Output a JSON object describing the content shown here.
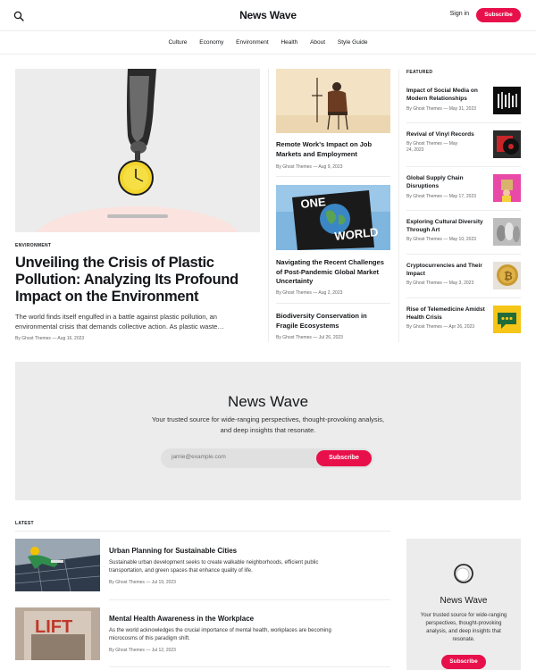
{
  "header": {
    "site_title": "News Wave",
    "signin_label": "Sign in",
    "subscribe_label": "Subscribe",
    "search_icon": "search-icon"
  },
  "nav": {
    "items": [
      {
        "label": "Culture"
      },
      {
        "label": "Economy"
      },
      {
        "label": "Environment"
      },
      {
        "label": "Health"
      },
      {
        "label": "About"
      },
      {
        "label": "Style Guide"
      }
    ]
  },
  "hero": {
    "tag": "ENVIRONMENT",
    "title": "Unveiling the Crisis of Plastic Pollution: Analyzing Its Profound Impact on the Environment",
    "excerpt": "The world finds itself engulfed in a battle against plastic pollution, an environmental crisis that demands collective action. As plastic waste…",
    "meta": "By Ghost Themes — Aug 16, 2023"
  },
  "middle": [
    {
      "title": "Remote Work's Impact on Job Markets and Employment",
      "meta": "By Ghost Themes — Aug 9, 2023"
    },
    {
      "title": "Navigating the Recent Challenges of Post-Pandemic Global Market Uncertainty",
      "meta": "By Ghost Themes — Aug 2, 2023",
      "image_text_1": "ONE",
      "image_text_2": "WORLD"
    },
    {
      "title": "Biodiversity Conservation in Fragile Ecosystems",
      "meta": "By Ghost Themes — Jul 26, 2023"
    }
  ],
  "featured": {
    "label": "FEATURED",
    "items": [
      {
        "title": "Impact of Social Media on Modern Relationships",
        "meta": "By Ghost Themes — May 31, 2023"
      },
      {
        "title": "Revival of Vinyl Records",
        "meta": "By Ghost Themes — May 24, 2023"
      },
      {
        "title": "Global Supply Chain Disruptions",
        "meta": "By Ghost Themes — May 17, 2023"
      },
      {
        "title": "Exploring Cultural Diversity Through Art",
        "meta": "By Ghost Themes — May 10, 2023"
      },
      {
        "title": "Cryptocurrencies and Their Impact",
        "meta": "By Ghost Themes — May 3, 2023"
      },
      {
        "title": "Rise of Telemedicine Amidst Health Crisis",
        "meta": "By Ghost Themes — Apr 26, 2023"
      }
    ]
  },
  "cta": {
    "title": "News Wave",
    "description": "Your trusted source for wide-ranging perspectives, thought-provoking analysis, and deep insights that resonate.",
    "email_placeholder": "jamie@example.com",
    "button_label": "Subscribe"
  },
  "latest": {
    "label": "LATEST",
    "items": [
      {
        "title": "Urban Planning for Sustainable Cities",
        "excerpt": "Sustainable urban development seeks to create walkable neighborhoods, efficient public transportation, and green spaces that enhance quality of life.",
        "meta": "By Ghost Themes — Jul 19, 2023"
      },
      {
        "title": "Mental Health Awareness in the Workplace",
        "excerpt": "As the world acknowledges the crucial importance of mental health, workplaces are becoming microcosms of this paradigm shift.",
        "meta": "By Ghost Themes — Jul 12, 2023",
        "image_text": "LIFT"
      }
    ]
  },
  "side_card": {
    "title": "News Wave",
    "description": "Your trusted source for wide-ranging perspectives, thought-provoking analysis, and deep insights that resonate.",
    "button_label": "Subscribe"
  },
  "colors": {
    "accent": "#e8104b",
    "panel": "#ececec",
    "text": "#15171a"
  }
}
